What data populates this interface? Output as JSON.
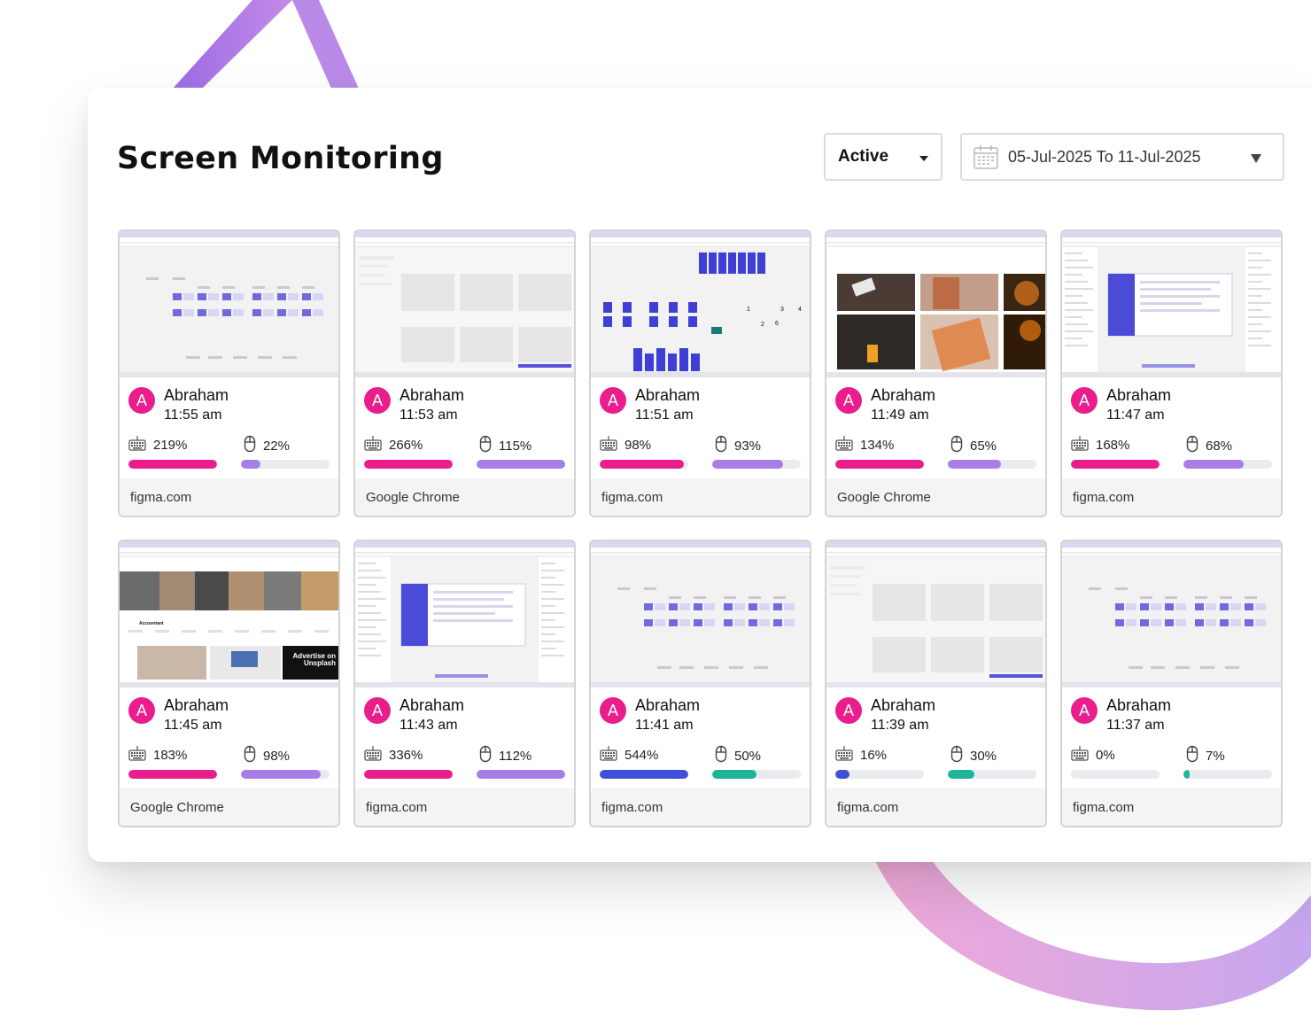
{
  "page": {
    "title": "Screen Monitoring",
    "status_filter": "Active",
    "date_range": "05-Jul-2025 To 11-Jul-2025"
  },
  "colors": {
    "avatar": "#e91e8c",
    "keyboard_bar": "#e91e8c",
    "mouse_bar": "#a77ee8",
    "low_keyboard_bar": "#3f4fd6",
    "low_mouse_bar": "#1fb39a"
  },
  "icons": {
    "keyboard": "keyboard-icon",
    "mouse": "mouse-icon",
    "calendar": "calendar-icon"
  },
  "cards": [
    {
      "user": "Abraham",
      "initial": "A",
      "time": "11:55 am",
      "keyboard": "219%",
      "keyboard_level": 1.0,
      "mouse": "22%",
      "mouse_level": 0.22,
      "app": "figma.com",
      "thumb": "figma-light"
    },
    {
      "user": "Abraham",
      "initial": "A",
      "time": "11:53 am",
      "keyboard": "266%",
      "keyboard_level": 1.0,
      "mouse": "115%",
      "mouse_level": 1.0,
      "app": "Google Chrome",
      "thumb": "blank"
    },
    {
      "user": "Abraham",
      "initial": "A",
      "time": "11:51 am",
      "keyboard": "98%",
      "keyboard_level": 0.95,
      "mouse": "93%",
      "mouse_level": 0.8,
      "app": "figma.com",
      "thumb": "figma-blue"
    },
    {
      "user": "Abraham",
      "initial": "A",
      "time": "11:49 am",
      "keyboard": "134%",
      "keyboard_level": 1.0,
      "mouse": "65%",
      "mouse_level": 0.6,
      "app": "Google Chrome",
      "thumb": "photos"
    },
    {
      "user": "Abraham",
      "initial": "A",
      "time": "11:47 am",
      "keyboard": "168%",
      "keyboard_level": 1.0,
      "mouse": "68%",
      "mouse_level": 0.68,
      "app": "figma.com",
      "thumb": "figma-panel"
    },
    {
      "user": "Abraham",
      "initial": "A",
      "time": "11:45 am",
      "keyboard": "183%",
      "keyboard_level": 1.0,
      "mouse": "98%",
      "mouse_level": 0.9,
      "app": "Google Chrome",
      "thumb": "unsplash",
      "overlay": "Advertise on Unsplash",
      "label": "Accountant"
    },
    {
      "user": "Abraham",
      "initial": "A",
      "time": "11:43 am",
      "keyboard": "336%",
      "keyboard_level": 1.0,
      "mouse": "112%",
      "mouse_level": 1.0,
      "app": "figma.com",
      "thumb": "figma-panel"
    },
    {
      "user": "Abraham",
      "initial": "A",
      "time": "11:41 am",
      "keyboard": "544%",
      "keyboard_level": 1.0,
      "mouse": "50%",
      "mouse_level": 0.5,
      "app": "figma.com",
      "thumb": "figma-light",
      "low": true
    },
    {
      "user": "Abraham",
      "initial": "A",
      "time": "11:39 am",
      "keyboard": "16%",
      "keyboard_level": 0.16,
      "mouse": "30%",
      "mouse_level": 0.3,
      "app": "figma.com",
      "thumb": "blank",
      "low": true
    },
    {
      "user": "Abraham",
      "initial": "A",
      "time": "11:37 am",
      "keyboard": "0%",
      "keyboard_level": 0.0,
      "mouse": "7%",
      "mouse_level": 0.07,
      "app": "figma.com",
      "thumb": "figma-light",
      "low": true
    }
  ]
}
